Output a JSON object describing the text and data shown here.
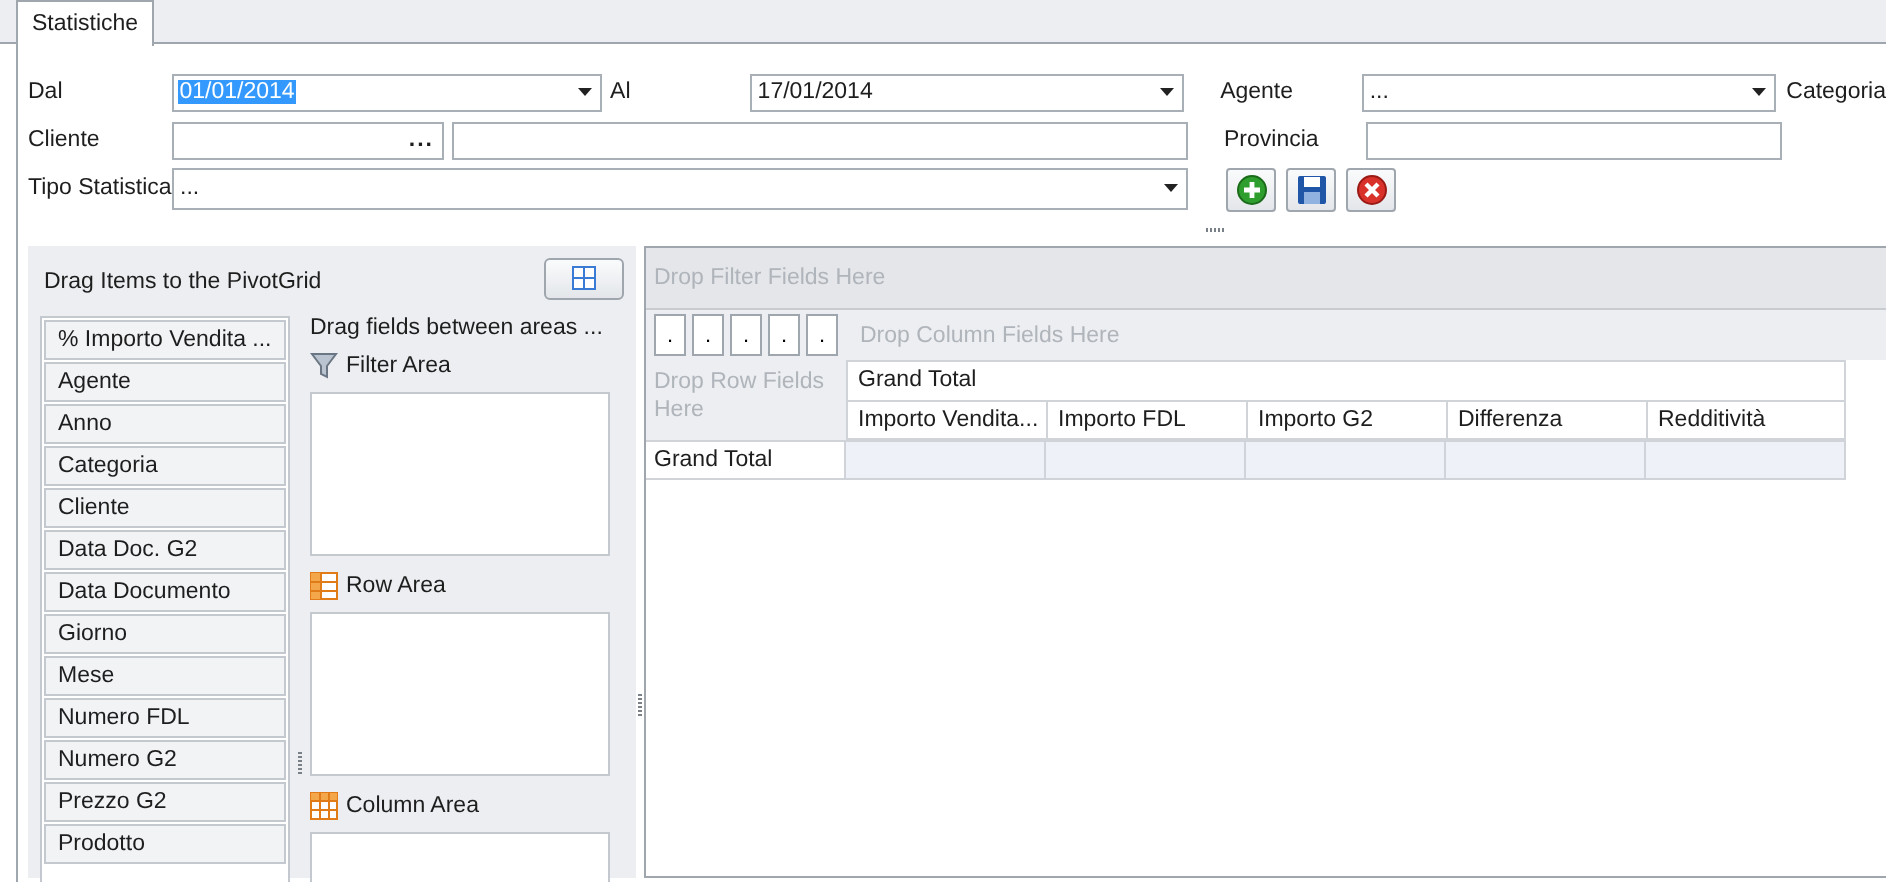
{
  "tabs": [
    {
      "label": "Statistiche",
      "selected": true
    }
  ],
  "filters": {
    "dal": {
      "label": "Dal",
      "value": "01/01/2014",
      "text_selected": true
    },
    "al": {
      "label": "Al",
      "value": "17/01/2014",
      "text_selected": false
    },
    "agente": {
      "label": "Agente",
      "value": "..."
    },
    "categoria": {
      "label": "Categoria"
    },
    "cliente": {
      "label": "Cliente",
      "button_text": "..."
    },
    "provincia": {
      "label": "Provincia"
    },
    "tipo": {
      "label": "Tipo Statistica",
      "value": "..."
    }
  },
  "actions": [
    {
      "kind": "add"
    },
    {
      "kind": "save"
    },
    {
      "kind": "cancel"
    }
  ],
  "customization": {
    "title": "Drag Items to the PivotGrid",
    "hint": "Drag fields between areas ...",
    "fields": [
      "% Importo Vendita ...",
      "Agente",
      "Anno",
      "Categoria",
      "Cliente",
      "Data Doc. G2",
      "Data Documento",
      "Giorno",
      "Mese",
      "Numero FDL",
      "Numero G2",
      "Prezzo G2",
      "Prodotto"
    ],
    "areas": [
      {
        "kind": "filter",
        "label": "Filter Area"
      },
      {
        "kind": "row",
        "label": "Row Area"
      },
      {
        "kind": "column",
        "label": "Column Area"
      }
    ]
  },
  "grid": {
    "filter_hint": "Drop Filter Fields Here",
    "column_hint": "Drop Column Fields Here",
    "row_hint": "Drop Row Fields Here",
    "column_buttons": [
      ".",
      ".",
      ".",
      ".",
      "."
    ],
    "header": "Grand Total",
    "columns": [
      "Importo Vendita...",
      "Importo FDL",
      "Importo G2",
      "Differenza",
      "Redditività"
    ],
    "rows": [
      {
        "label": "Grand Total"
      }
    ]
  }
}
